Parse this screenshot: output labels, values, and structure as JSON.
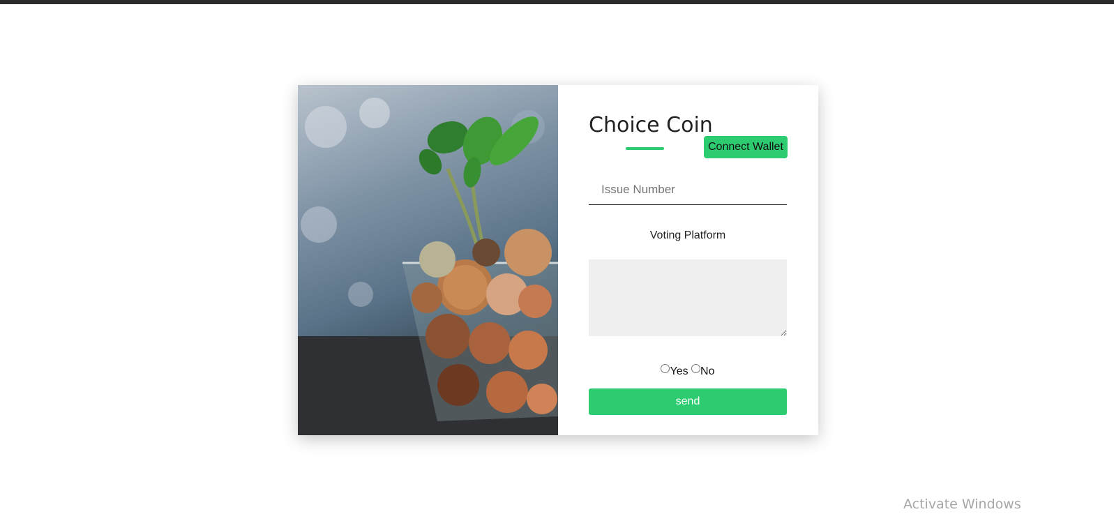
{
  "form": {
    "title": "Choice Coin",
    "connect_label": "Connect Wallet",
    "issue_placeholder": "Issue Number",
    "issue_value": "",
    "platform_label": "Voting Platform",
    "message_value": "",
    "options": [
      {
        "label": "Yes",
        "checked": false
      },
      {
        "label": "No",
        "checked": false
      }
    ],
    "send_label": "send"
  },
  "photo": {
    "subject": "plant-growing-from-glass-of-coins"
  },
  "os_overlay": {
    "watermark": "Activate Windows"
  },
  "colors": {
    "accent": "#2ecc71",
    "textarea_bg": "#efefef"
  }
}
